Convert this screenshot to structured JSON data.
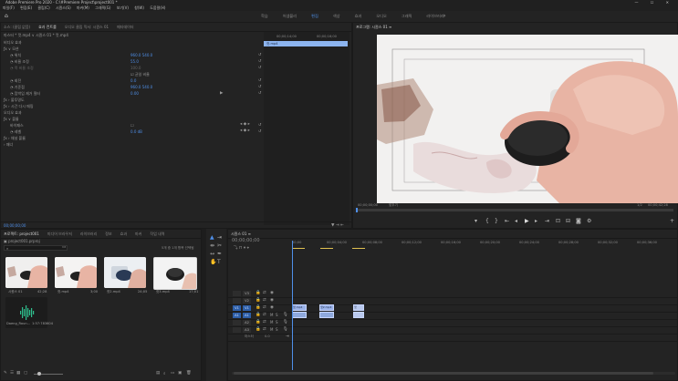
{
  "window": {
    "title": "Adobe Premiere Pro 2020 - C:\\#Premiere Project\\project001 *",
    "controls": "—  ☐  ✕"
  },
  "menu": [
    "파일(F)",
    "편집(E)",
    "클립(C)",
    "시퀀스(S)",
    "마커(M)",
    "그래픽(G)",
    "보기(V)",
    "창(W)",
    "도움말(H)"
  ],
  "workspaces": {
    "tabs": [
      "학습",
      "어셈블리",
      "편집",
      "색상",
      "효과",
      "오디오",
      "그래픽",
      "라이브러리"
    ],
    "active_index": 2,
    "more": "»"
  },
  "effect_controls": {
    "tabs": [
      "소스: (클립 없음)",
      "효과 컨트롤",
      "오디오 클립 믹서: 시퀀스 01",
      "메타데이터"
    ],
    "active_tab": 1,
    "source_line": "마스터 * 컷.mp4  ∨  시퀀스 01 * 컷.mp4",
    "timecode_a": "00;00;14;00",
    "timecode_b": "00;00;16;00",
    "clip_name": "컷.mp4",
    "section_video": "비디오 효과",
    "fx_motion": "모션",
    "position_label": "위치",
    "position_value": "960.0    540.0",
    "scale_label": "비율 조정",
    "scale_value": "55.0",
    "scale_width_label": "폭 비율 조정",
    "scale_width_value": "100.0",
    "uniform_label": "균일 비율",
    "rotation_label": "회전",
    "rotation_value": "0.0",
    "anchor_label": "기준점",
    "anchor_value": "960.0    540.0",
    "flicker_label": "깜박임 제거 필터",
    "flicker_value": "0.00",
    "opacity_label": "불투명도",
    "time_remap_label": "시간 다시 매핑",
    "section_audio": "오디오 효과",
    "volume_label": "볼륨",
    "bypass_label": "바이패스",
    "level_label": "레벨",
    "level_value": "0.0 dB",
    "channel_label": "채널 볼륨",
    "panner_label": "패너",
    "playhead_tc": "00;00;00;00"
  },
  "program_monitor": {
    "title": "프로그램: 시퀀스 01  ≡",
    "timecode_left": "00;00;00;00",
    "fit_label": "맞추기",
    "quality_label": "1/2",
    "timecode_right": "00;00;42;28"
  },
  "project": {
    "tabs": [
      "프로젝트: project001",
      "미디어 브라우저",
      "라이브러리",
      "정보",
      "효과",
      "마커",
      "작업 내역"
    ],
    "active_tab": 0,
    "path": "project001.prproj",
    "selection_info": "5개 중 1개 항목 선택됨",
    "items": [
      {
        "name": "시퀀스 01",
        "duration": "42;28"
      },
      {
        "name": "컷.mp4",
        "duration": "3;00"
      },
      {
        "name": "컷2.mp4",
        "duration": "24;05"
      },
      {
        "name": "컷3.mp4",
        "duration": "17;01"
      },
      {
        "name": "Daeng_Roun...",
        "duration": "1:57:783604"
      }
    ]
  },
  "timeline": {
    "title": "시퀀스 01  ≡",
    "timecode": "00;00;00;00",
    "ruler": [
      "00;00",
      "00;00;04;00",
      "00;00;08;00",
      "00;00;12;00",
      "00;00;16;00",
      "00;00;20;00",
      "00;00;24;00",
      "00;00;28;00",
      "00;00;32;00",
      "00;00;36;00"
    ],
    "tracks": [
      "V3",
      "V2",
      "V1",
      "A1",
      "A2",
      "A3"
    ],
    "master_label": "마스터",
    "master_value": "0.0",
    "clips": [
      {
        "track": "V1",
        "label": "컷.mp4"
      },
      {
        "track": "V1",
        "label": "컷2.mp4"
      },
      {
        "track": "V1",
        "label": "컷3.mp4"
      }
    ]
  },
  "colors": {
    "accent": "#4f8fe8",
    "panel_bg": "#232323",
    "clip_video": "#9ab2e8",
    "clip_audio": "#8fa9dd"
  }
}
